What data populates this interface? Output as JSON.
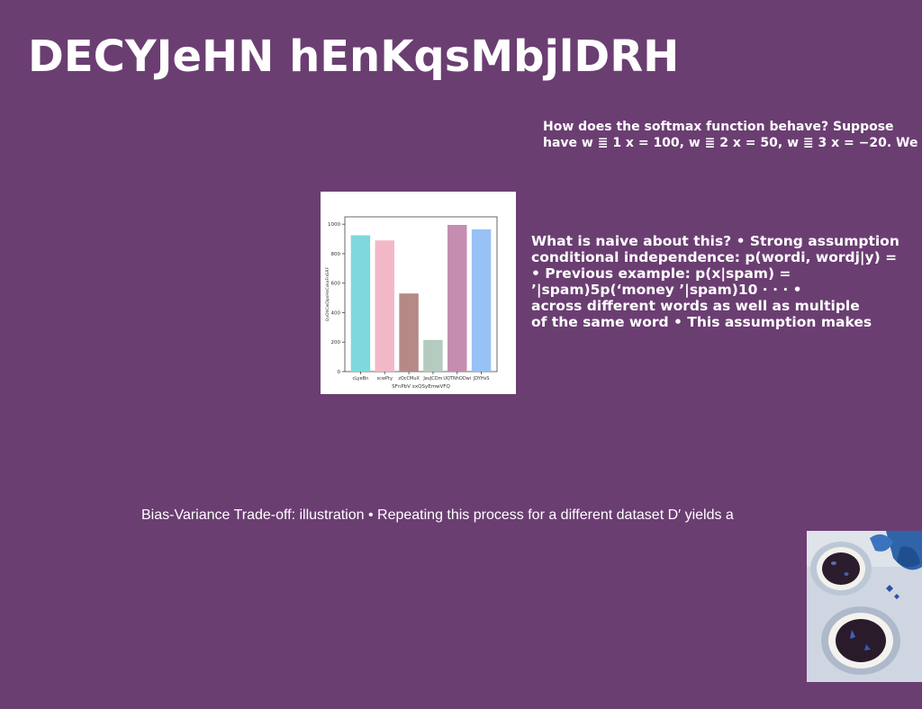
{
  "slide": {
    "title": "DECYJeHN hEnKqsMbjlDRH"
  },
  "softmax_block": {
    "lines": [
      "How does the softmax function behave? Suppose",
      "have w ≣ 1 x = 100, w ≣ 2 x = 50, w ≣ 3 x = −20. We"
    ]
  },
  "naive_block": {
    "lines": [
      "What is naive about this? • Strong assumption",
      "conditional independence: p(wordi, wordj|y) =",
      "• Previous example: p(x|spam) =",
      "’|spam)5p(‘money ’|spam)10 · · · •",
      "across different words as well as multiple",
      "of the same word • This assumption makes"
    ]
  },
  "caption": {
    "text": "Bias-Variance Trade-off: illustration • Repeating this process for a different dataset D′ yields a"
  },
  "chart_data": {
    "type": "bar",
    "categories": [
      "cLyeBn",
      "scwPty",
      "zOcCMuX",
      "JavJCDm",
      "UQTNhODwi",
      "JDYHsS"
    ],
    "values": [
      925,
      890,
      530,
      215,
      995,
      965
    ],
    "colors": [
      "#7fd9dc",
      "#f3b8c8",
      "#b58a86",
      "#b3ccbf",
      "#c58daf",
      "#98c1f5"
    ],
    "ylim": [
      0,
      1050
    ],
    "yticks": [
      0,
      200,
      400,
      600,
      800,
      1000
    ],
    "xlabel": "SFnPbV xxQSyEmwVFQ",
    "ylabel": "QvOhCwDpxHnCvkaFnGRF",
    "grid": false
  },
  "photo": {
    "icon": "tea-cups-photo"
  }
}
